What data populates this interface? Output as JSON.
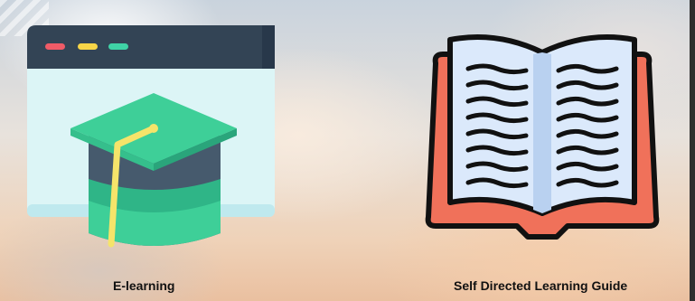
{
  "cards": [
    {
      "id": "elearning",
      "label": "E-learning",
      "icon": "graduation-cap-browser-icon"
    },
    {
      "id": "self-directed-learning-guide",
      "label": "Self Directed Learning Guide",
      "icon": "open-book-icon"
    }
  ],
  "colors": {
    "browser_frame": "#334455",
    "browser_window": "#dcf5f6",
    "cap_top": "#3ecf98",
    "cap_body": "#465a6d",
    "tassel": "#f5e46a",
    "dot_red": "#ef5b67",
    "dot_yellow": "#f7d547",
    "dot_green": "#3fd3a6",
    "book_cover": "#f0715a",
    "book_page": "#dbe9fb",
    "book_outline": "#111111"
  }
}
